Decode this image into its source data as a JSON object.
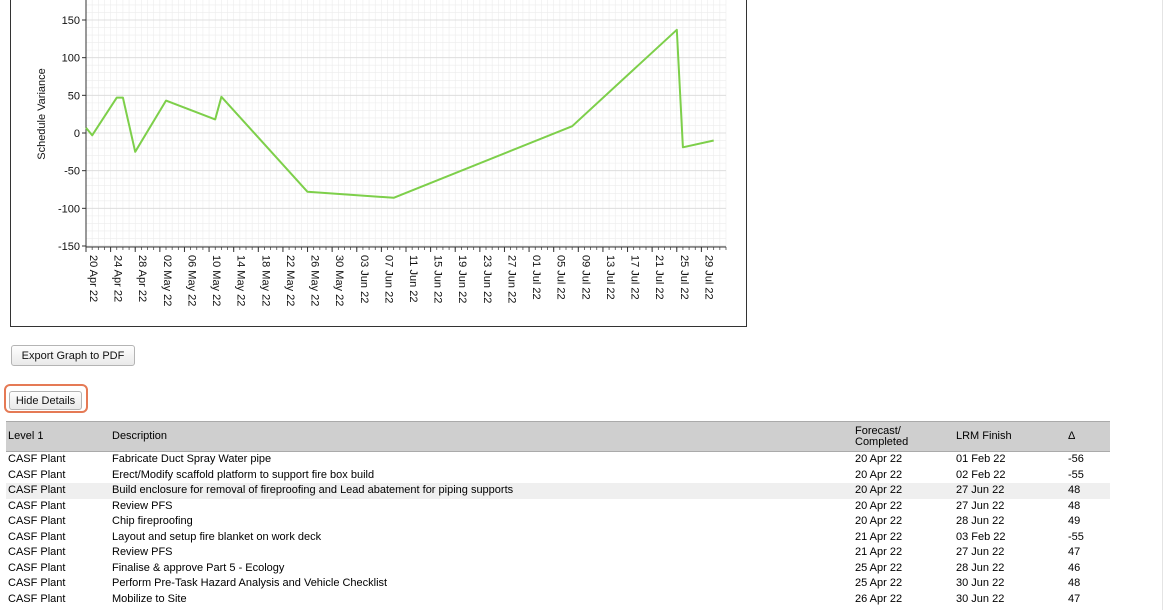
{
  "chart_data": {
    "type": "line",
    "ylabel": "Schedule Variance",
    "ylim": [
      -150,
      175
    ],
    "yticks": [
      150,
      100,
      50,
      0,
      -50,
      -100,
      -150
    ],
    "xlabels": [
      "20 Apr 22",
      "24 Apr 22",
      "28 Apr 22",
      "02 May 22",
      "06 May 22",
      "10 May 22",
      "14 May 22",
      "18 May 22",
      "22 May 22",
      "26 May 22",
      "30 May 22",
      "03 Jun 22",
      "07 Jun 22",
      "11 Jun 22",
      "15 Jun 22",
      "19 Jun 22",
      "23 Jun 22",
      "27 Jun 22",
      "01 Jul 22",
      "05 Jul 22",
      "09 Jul 22",
      "13 Jul 22",
      "17 Jul 22",
      "21 Jul 22",
      "25 Jul 22",
      "29 Jul 22"
    ],
    "series": [
      {
        "color": "#7dcf4a",
        "points": [
          [
            "20 Apr 22",
            7
          ],
          [
            "21 Apr 22",
            -3
          ],
          [
            "25 Apr 22",
            47
          ],
          [
            "26 Apr 22",
            47
          ],
          [
            "28 Apr 22",
            -25
          ],
          [
            "03 May 22",
            43
          ],
          [
            "11 May 22",
            18
          ],
          [
            "12 May 22",
            48
          ],
          [
            "26 May 22",
            -78
          ],
          [
            "09 Jun 22",
            -86
          ],
          [
            "08 Jul 22",
            9
          ],
          [
            "25 Jul 22",
            137
          ],
          [
            "26 Jul 22",
            -19
          ],
          [
            "31 Jul 22",
            -10
          ]
        ]
      }
    ],
    "grid": true
  },
  "buttons": {
    "export": "Export Graph to PDF",
    "hide_details": "Hide Details"
  },
  "table": {
    "headers": [
      "Level 1",
      "Description",
      "Forecast/ Completed",
      "LRM Finish",
      "Δ"
    ],
    "rows": [
      [
        "CASF Plant",
        "Fabricate Duct Spray Water pipe",
        "20 Apr 22",
        "01 Feb 22",
        "-56"
      ],
      [
        "CASF Plant",
        "Erect/Modify scaffold platform to support fire box build",
        "20 Apr 22",
        "02 Feb 22",
        "-55"
      ],
      [
        "CASF Plant",
        "Build enclosure for removal of fireproofing and Lead abatement for piping supports",
        "20 Apr 22",
        "27 Jun 22",
        "48"
      ],
      [
        "CASF Plant",
        "Review PFS",
        "20 Apr 22",
        "27 Jun 22",
        "48"
      ],
      [
        "CASF Plant",
        "Chip fireproofing",
        "20 Apr 22",
        "28 Jun 22",
        "49"
      ],
      [
        "CASF Plant",
        "Layout and setup fire blanket on work deck",
        "21 Apr 22",
        "03 Feb 22",
        "-55"
      ],
      [
        "CASF Plant",
        "Review PFS",
        "21 Apr 22",
        "27 Jun 22",
        "47"
      ],
      [
        "CASF Plant",
        "Finalise & approve Part 5 - Ecology",
        "25 Apr 22",
        "28 Jun 22",
        "46"
      ],
      [
        "CASF Plant",
        "Perform Pre-Task Hazard Analysis and Vehicle Checklist",
        "25 Apr 22",
        "30 Jun 22",
        "48"
      ],
      [
        "CASF Plant",
        "Mobilize to Site",
        "26 Apr 22",
        "30 Jun 22",
        "47"
      ]
    ]
  }
}
